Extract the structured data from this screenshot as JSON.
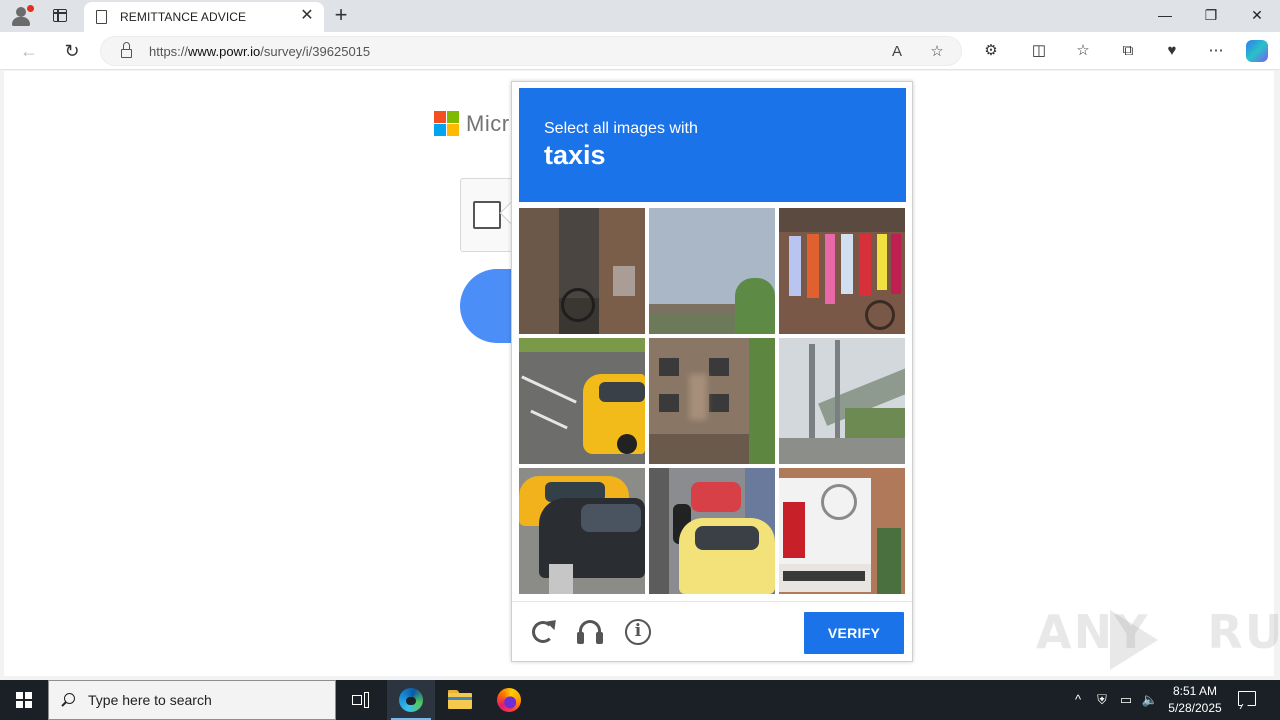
{
  "browser": {
    "tab_title": "REMITTANCE ADVICE",
    "url_prefix": "https://",
    "url_host": "www.powr.io",
    "url_path": "/survey/i/39625015",
    "new_tab_symbol": "+",
    "close_symbol": "✕",
    "window_buttons": [
      "—",
      "❐",
      "✕"
    ]
  },
  "page": {
    "brand_partial": "Micr"
  },
  "captcha": {
    "prompt_line1": "Select all images with",
    "prompt_target": "taxis",
    "verify_label": "VERIFY",
    "info_glyph": "i",
    "tiles": [
      {
        "subject": "bicycle-near-brick-wall"
      },
      {
        "subject": "highway-bridge"
      },
      {
        "subject": "clothes-hanging-with-bicycle"
      },
      {
        "subject": "yellow-taxi-on-road"
      },
      {
        "subject": "apartment-building"
      },
      {
        "subject": "elevated-highway"
      },
      {
        "subject": "yellow-taxi-and-dark-car"
      },
      {
        "subject": "street-traffic-with-taxi"
      },
      {
        "subject": "storefront-sign"
      }
    ]
  },
  "watermark": {
    "text_left": "ANY",
    "text_right": "RUN"
  },
  "taskbar": {
    "search_placeholder": "Type here to search",
    "time": "8:51 AM",
    "date": "5/28/2025"
  },
  "colors": {
    "captcha_blue": "#1a73e8",
    "taskbar_bg": "#1b2027"
  }
}
